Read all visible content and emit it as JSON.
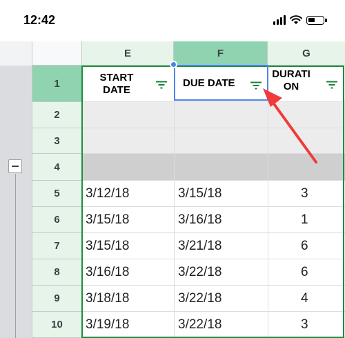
{
  "status_bar": {
    "time": "12:42",
    "icons": [
      "signal-icon",
      "wifi-icon",
      "battery-icon"
    ]
  },
  "sheet": {
    "columns": [
      {
        "letter": "E",
        "header": "START DATE",
        "header_lines": [
          "START",
          "DATE"
        ]
      },
      {
        "letter": "F",
        "header": "DUE DATE",
        "header_lines": [
          "DUE DATE"
        ]
      },
      {
        "letter": "G",
        "header": "DURATION",
        "header_lines": [
          "DURATI",
          "ON"
        ]
      }
    ],
    "row_numbers": [
      "1",
      "2",
      "3",
      "4",
      "5",
      "6",
      "7",
      "8",
      "9",
      "10"
    ],
    "rows": [
      {
        "row": "5",
        "start": "3/12/18",
        "due": "3/15/18",
        "duration": "3"
      },
      {
        "row": "6",
        "start": "3/15/18",
        "due": "3/16/18",
        "duration": "1"
      },
      {
        "row": "7",
        "start": "3/15/18",
        "due": "3/21/18",
        "duration": "6"
      },
      {
        "row": "8",
        "start": "3/16/18",
        "due": "3/22/18",
        "duration": "6"
      },
      {
        "row": "9",
        "start": "3/18/18",
        "due": "3/22/18",
        "duration": "4"
      },
      {
        "row": "10",
        "start": "3/19/18",
        "due": "3/22/18",
        "duration": "3"
      }
    ],
    "selected_column": "F",
    "selected_row": "1",
    "icons": [
      "filter-icon",
      "collapse-group-icon"
    ],
    "colors": {
      "header_green": "#e6f4ea",
      "selected_green": "#8fd3b0",
      "range_border": "#1e8e3e",
      "active_cell_border": "#4a86e8",
      "annotation_arrow": "#f23a3a"
    }
  }
}
